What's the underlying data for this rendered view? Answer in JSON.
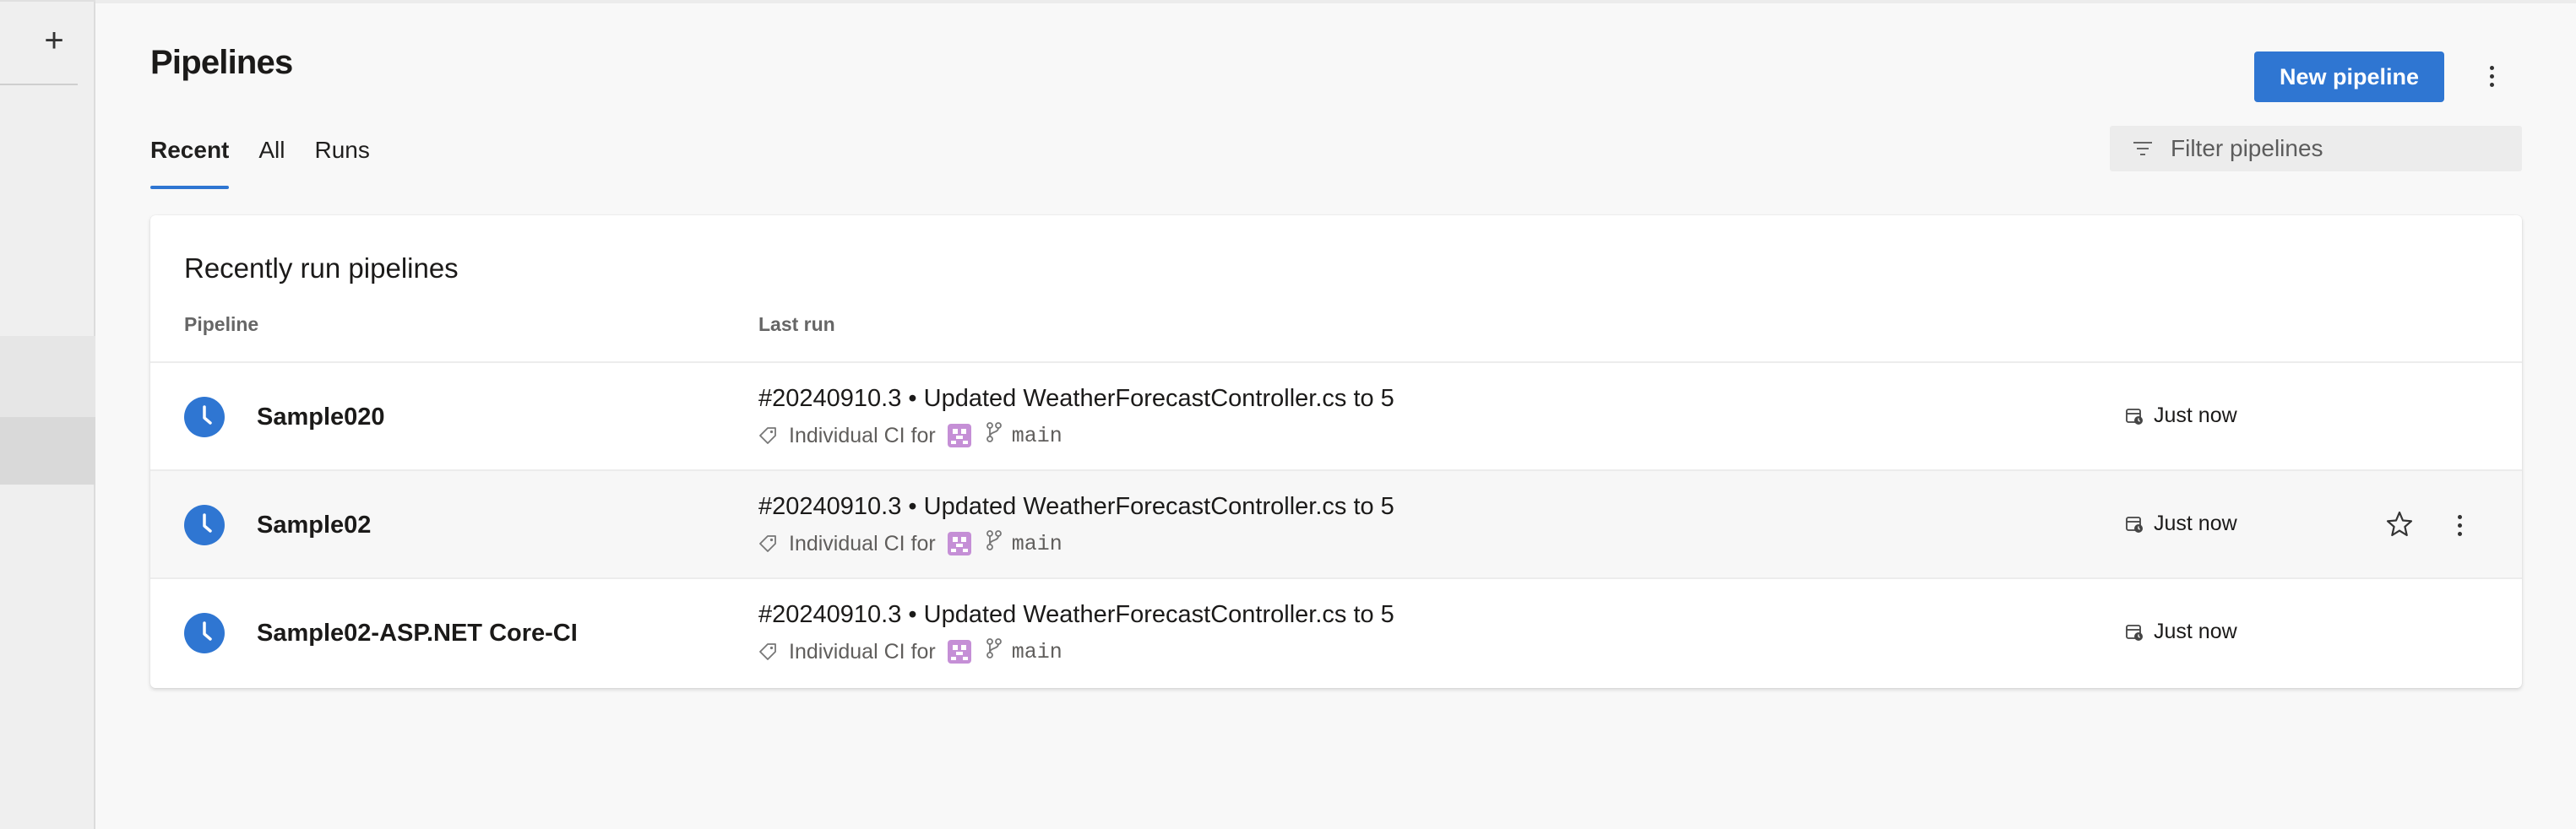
{
  "page": {
    "title": "Pipelines",
    "new_button": "New pipeline"
  },
  "tabs": [
    {
      "label": "Recent",
      "active": true
    },
    {
      "label": "All",
      "active": false
    },
    {
      "label": "Runs",
      "active": false
    }
  ],
  "filter": {
    "placeholder": "Filter pipelines"
  },
  "card": {
    "title": "Recently run pipelines",
    "col_pipeline": "Pipeline",
    "col_last_run": "Last run"
  },
  "rows": [
    {
      "name": "Sample020",
      "run_number": "#20240910.3",
      "separator": "•",
      "commit": "Updated WeatherForecastController.cs to 5",
      "trigger": "Individual CI for",
      "branch": "main",
      "time": "Just now",
      "status": "queued-clock-icon"
    },
    {
      "name": "Sample02",
      "run_number": "#20240910.3",
      "separator": "•",
      "commit": "Updated WeatherForecastController.cs to 5",
      "trigger": "Individual CI for",
      "branch": "main",
      "time": "Just now",
      "status": "queued-clock-icon"
    },
    {
      "name": "Sample02-ASP.NET Core-CI",
      "run_number": "#20240910.3",
      "separator": "•",
      "commit": "Updated WeatherForecastController.cs to 5",
      "trigger": "Individual CI for",
      "branch": "main",
      "time": "Just now",
      "status": "queued-clock-icon"
    }
  ],
  "colors": {
    "accent": "#2f76d2",
    "avatar": "#c58fd6"
  }
}
